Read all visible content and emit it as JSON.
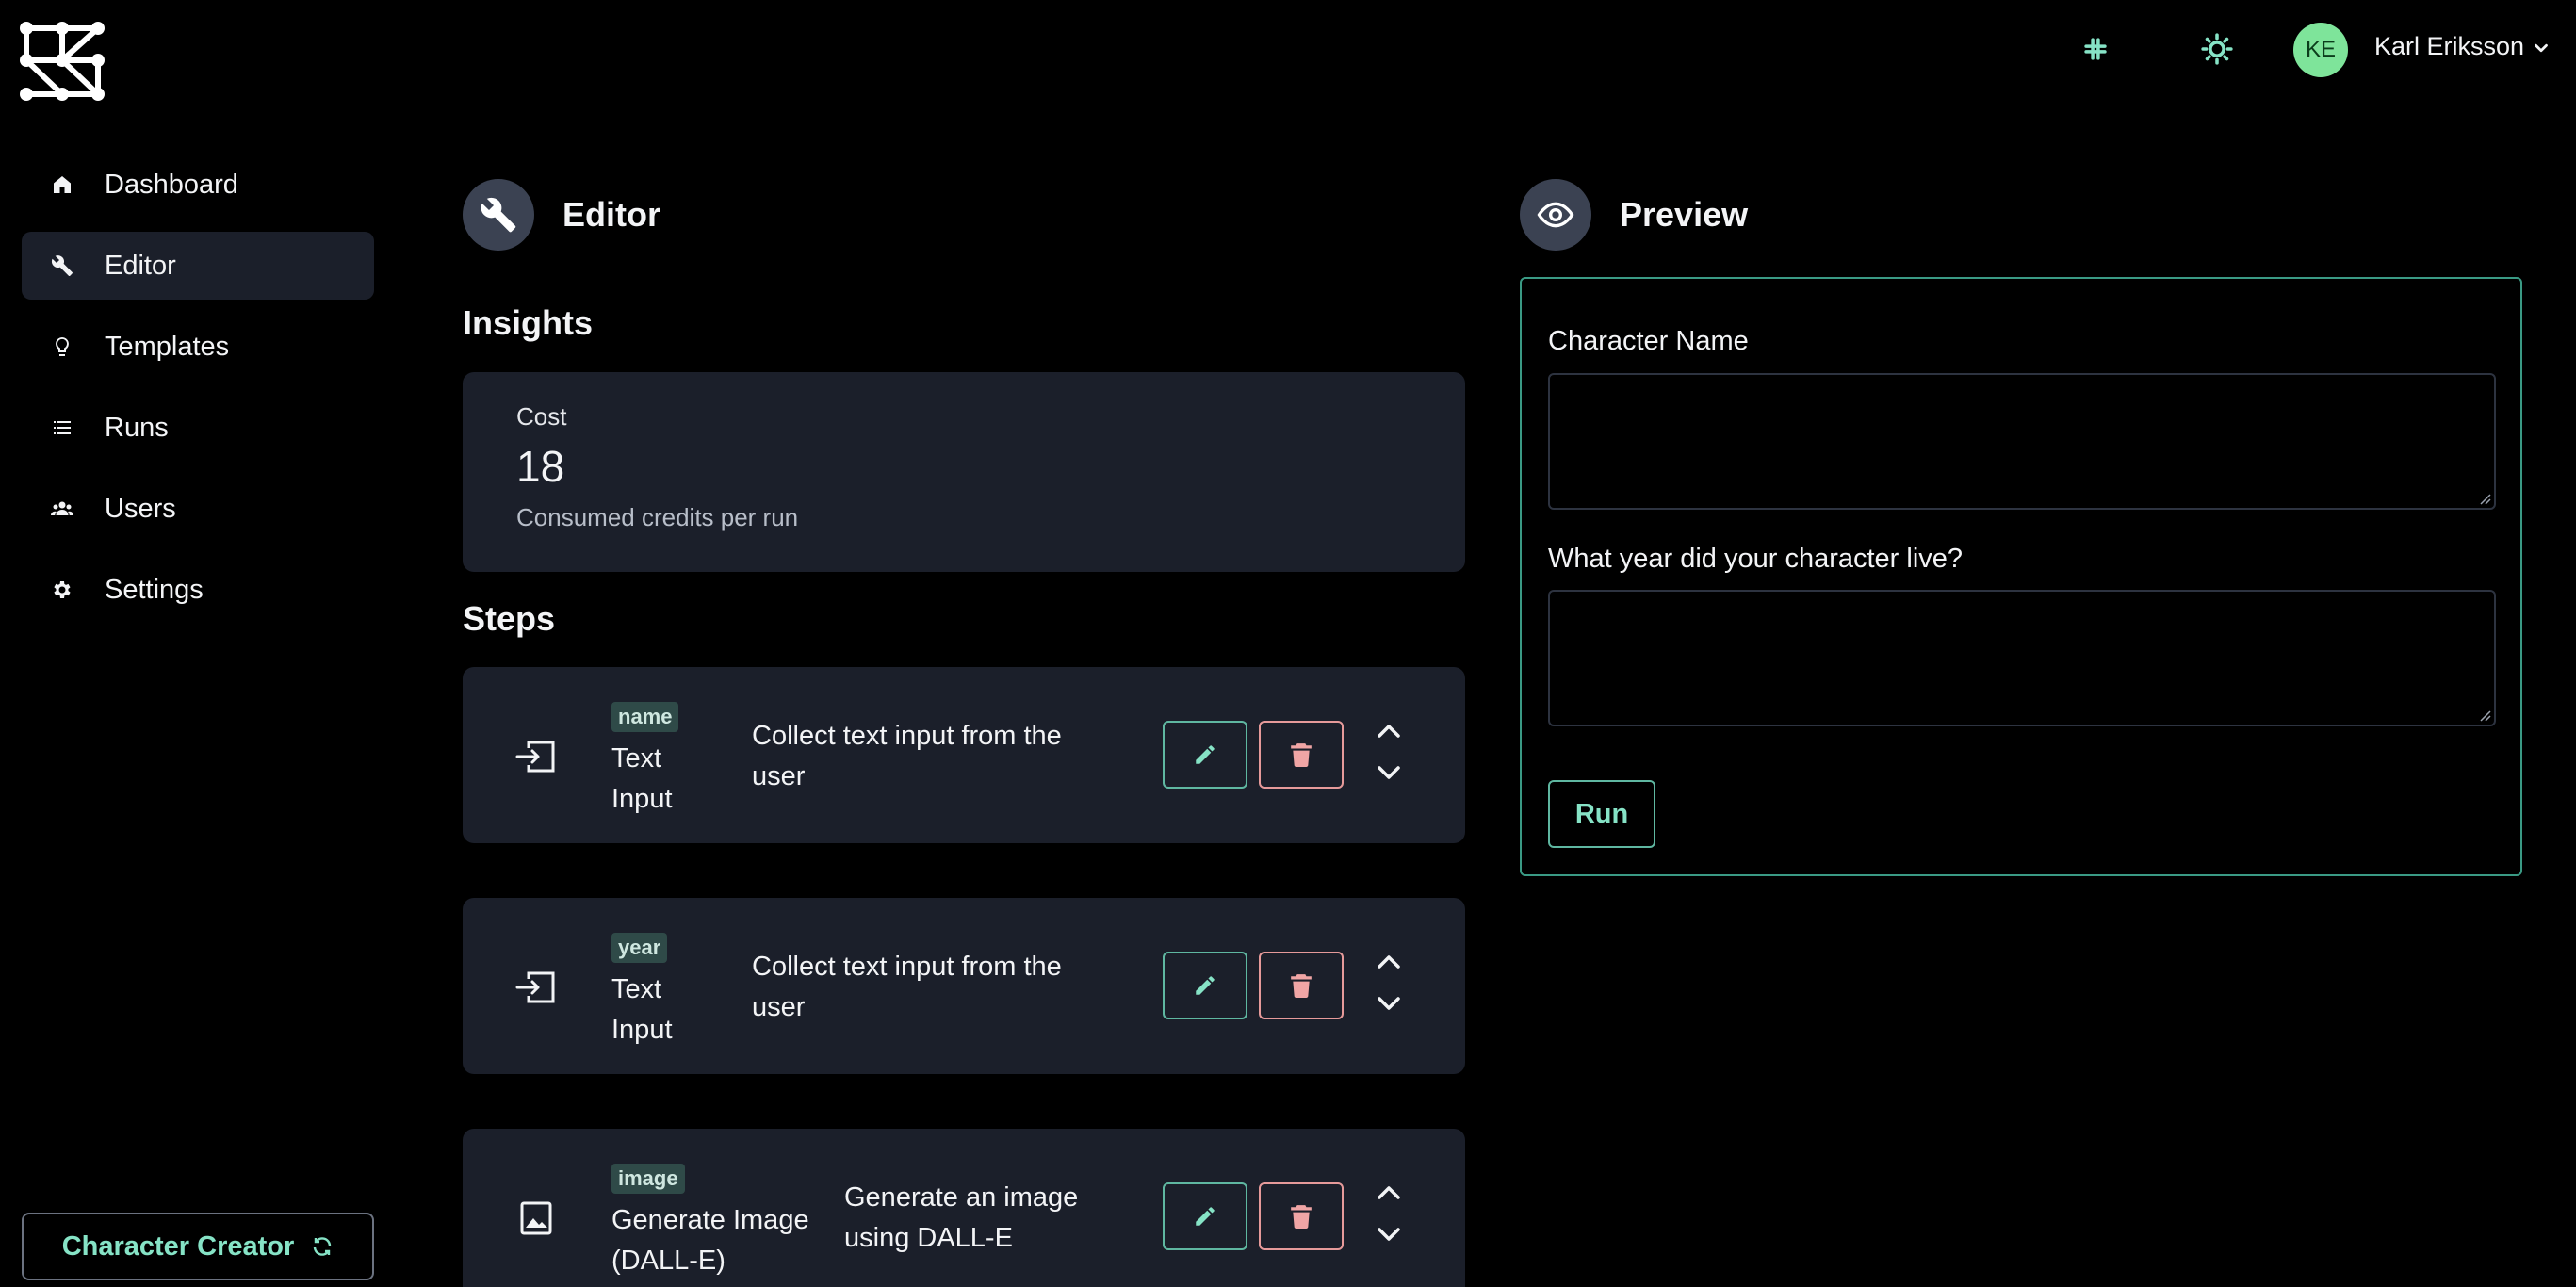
{
  "sidebar": {
    "items": [
      {
        "label": "Dashboard",
        "icon": "home-icon"
      },
      {
        "label": "Editor",
        "icon": "wrench-icon",
        "active": true
      },
      {
        "label": "Templates",
        "icon": "lightbulb-icon"
      },
      {
        "label": "Runs",
        "icon": "list-icon"
      },
      {
        "label": "Users",
        "icon": "users-icon"
      },
      {
        "label": "Settings",
        "icon": "gear-icon"
      }
    ],
    "project_button": "Character Creator"
  },
  "header": {
    "user_initials": "KE",
    "user_name": "Karl Eriksson"
  },
  "editor": {
    "title": "Editor",
    "insights_heading": "Insights",
    "insight": {
      "label": "Cost",
      "value": "18",
      "description": "Consumed credits per run"
    },
    "steps_heading": "Steps",
    "steps": [
      {
        "tag": "name",
        "type_line1": "Text",
        "type_line2": "Input",
        "desc_line1": "Collect text input from the",
        "desc_line2": "user",
        "icon": "text-input-icon"
      },
      {
        "tag": "year",
        "type_line1": "Text",
        "type_line2": "Input",
        "desc_line1": "Collect text input from the",
        "desc_line2": "user",
        "icon": "text-input-icon"
      },
      {
        "tag": "image",
        "type_line1": "Generate Image",
        "type_line2": "(DALL-E)",
        "desc_line1": "Generate an image",
        "desc_line2": "using DALL-E",
        "icon": "image-icon"
      }
    ]
  },
  "preview": {
    "title": "Preview",
    "fields": [
      {
        "label": "Character Name",
        "value": ""
      },
      {
        "label": "What year did your character live?",
        "value": ""
      }
    ],
    "run_label": "Run"
  },
  "colors": {
    "accent": "#86e3c6",
    "card_bg": "#1b1f2a",
    "danger": "#f0a5a5",
    "avatar_bg": "#7ee49a"
  }
}
